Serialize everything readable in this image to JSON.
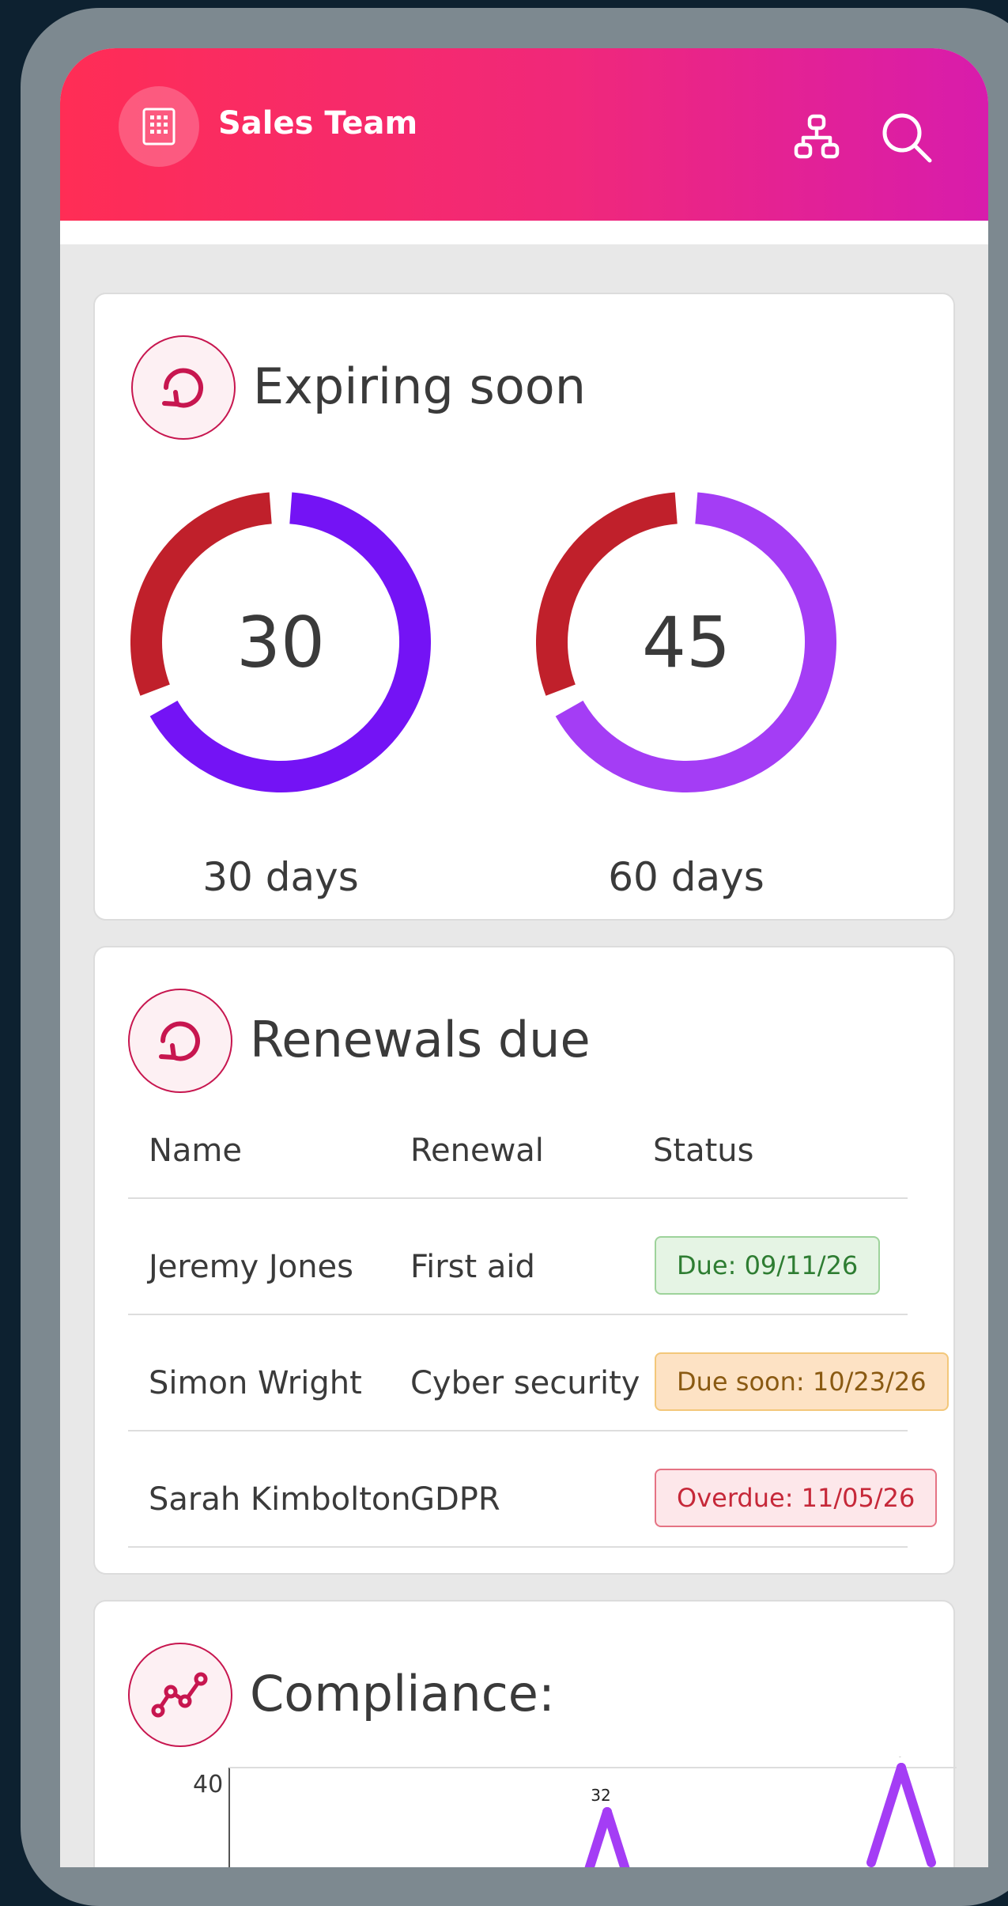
{
  "header": {
    "title": "Sales Team",
    "logo_icon": "building-icon",
    "actions": [
      "org-chart-icon",
      "search-icon"
    ],
    "gradient": [
      "#ff2d55",
      "#d81cac"
    ]
  },
  "expiring": {
    "title": "Expiring soon",
    "icon": "refresh-icon",
    "donuts": [
      {
        "value": "30",
        "label": "30 days",
        "fraction_red": 0.32,
        "color_main": "#7413f5",
        "color_red": "#c0202b"
      },
      {
        "value": "45",
        "label": "60 days",
        "fraction_red": 0.32,
        "color_main": "#a43df5",
        "color_red": "#c0202b"
      }
    ]
  },
  "renewals": {
    "title": "Renewals due",
    "icon": "refresh-icon",
    "columns": [
      "Name",
      "Renewal",
      "Status"
    ],
    "rows": [
      {
        "name": "Jeremy Jones",
        "renewal": "First aid",
        "status": "Due: 09/11/26",
        "status_type": "due"
      },
      {
        "name": "Simon Wright",
        "renewal": "Cyber security",
        "status": "Due soon: 10/23/26",
        "status_type": "soon"
      },
      {
        "name": "Sarah Kimbolton",
        "renewal": "GDPR",
        "status": "Overdue: 11/05/26",
        "status_type": "overdue"
      }
    ],
    "status_colors": {
      "due": {
        "bg": "#e5f4e4",
        "border": "#9ed39b",
        "text": "#2e7d32"
      },
      "soon": {
        "bg": "#fde2c4",
        "border": "#f3c77a",
        "text": "#8a5a12"
      },
      "overdue": {
        "bg": "#fde7ea",
        "border": "#e57384",
        "text": "#c62839"
      }
    }
  },
  "compliance": {
    "title": "Compliance:",
    "icon": "line-chart-icon"
  },
  "chart_data": {
    "type": "line",
    "title": "",
    "y_ticks": [
      "40"
    ],
    "series": [
      {
        "values": [
          32,
          40
        ],
        "labels": [
          "32",
          "40"
        ],
        "color": "#a43df5"
      }
    ]
  }
}
